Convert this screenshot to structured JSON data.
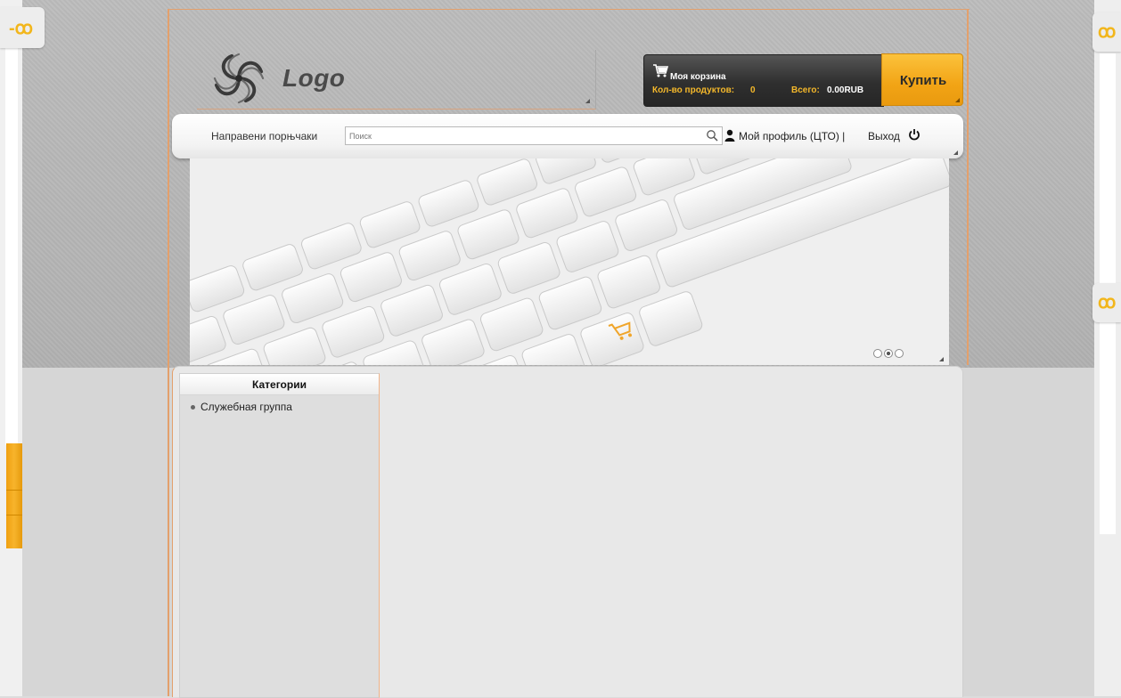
{
  "header": {
    "logo_text": "Logo"
  },
  "cart": {
    "title": "Моя корзина",
    "count_label": "Кол-во продуктов:",
    "count": "0",
    "total_label": "Всего:",
    "total": "0.00RUB",
    "buy_label": "Купить"
  },
  "nav": {
    "link_label": "Направени порњчаки",
    "search_placeholder": "Поиск",
    "profile_label": "Мой профиль (ЦТО) |",
    "logout_label": "Выход"
  },
  "banner": {
    "slides": 3,
    "active_slide": 2
  },
  "sidebar": {
    "title": "Категории",
    "items": [
      {
        "label": "Служебная группа"
      }
    ]
  },
  "colors": {
    "accent": "#f2a415",
    "frame": "#e3a06c",
    "cart_bg": "#2f2f2f"
  },
  "icons": [
    "logo-swirl-icon",
    "cart-icon",
    "search-icon",
    "user-icon",
    "power-icon",
    "shopping-cart-key-icon",
    "pin-icon"
  ]
}
